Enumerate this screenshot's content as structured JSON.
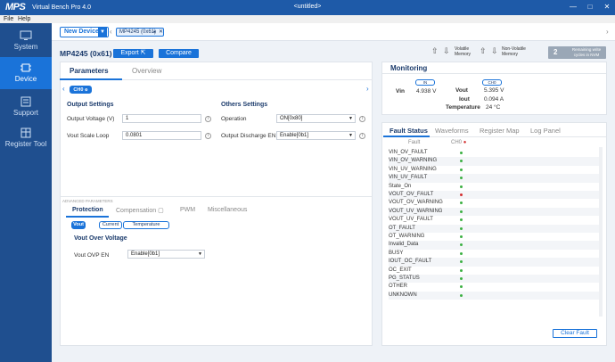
{
  "app": {
    "logo": "MPS",
    "title": "Virtual Bench Pro 4.0",
    "document_title": "<untitled>",
    "window_buttons": [
      "—",
      "□",
      "✕"
    ]
  },
  "menu": [
    "File",
    "Help"
  ],
  "sidebar": [
    {
      "label": "System",
      "icon": "monitor-icon",
      "active": false
    },
    {
      "label": "Device",
      "icon": "chip-icon",
      "active": true
    },
    {
      "label": "Support",
      "icon": "support-icon",
      "active": false
    },
    {
      "label": "Register Tool",
      "icon": "register-tool-icon",
      "active": false
    }
  ],
  "toolbar": {
    "new_device": "New Device",
    "device_tab": "MP4245 (0x61)"
  },
  "device": {
    "title": "MP4245 (0x61)",
    "export_label": "Export",
    "compare_label": "Compare",
    "volatile_label": "Volatile Memory",
    "nonvolatile_label": "Non-Volatile Memory",
    "nvm_count": "2",
    "nvm_text": "Remaining write cycles in NVM"
  },
  "left": {
    "tabs": [
      "Parameters",
      "Overview"
    ],
    "channel": "CH0",
    "output_settings": {
      "title": "Output Settings",
      "rows": [
        {
          "label": "Output Voltage (V)",
          "value": "1"
        },
        {
          "label": "Vout Scale Loop",
          "value": "0.0801"
        }
      ]
    },
    "other_settings": {
      "title": "Others Settings",
      "rows": [
        {
          "label": "Operation",
          "value": "ON[0x80]"
        },
        {
          "label": "Output Discharge EN",
          "value": "Enable[0b1]"
        }
      ]
    },
    "advanced_label": "ADVANCED PARAMETERS",
    "adv_tabs": [
      "Protection",
      "Compensation",
      "PWM",
      "Miscellaneous"
    ],
    "pills": [
      "Vout",
      "Current",
      "Temperature"
    ],
    "ovp": {
      "title": "Vout Over Voltage",
      "label": "Vout OVP EN",
      "value": "Enable[0b1]"
    }
  },
  "monitoring": {
    "title": "Monitoring",
    "vin_badge": "IN",
    "vin_label": "Vin",
    "vin_value": "4.938 V",
    "ch_badge": "CH0",
    "vout_label": "Vout",
    "vout_value": "5.395 V",
    "iout_label": "Iout",
    "iout_value": "0.094 A",
    "temp_label": "Temperature",
    "temp_value": "24 °C"
  },
  "fault": {
    "tabs": [
      "Fault Status",
      "Waveforms",
      "Register Map",
      "Log Panel"
    ],
    "col_fault": "Fault",
    "col_ch": "CH0",
    "rows": [
      {
        "name": "VIN_OV_FAULT",
        "status": "ok"
      },
      {
        "name": "VIN_OV_WARNING",
        "status": "ok"
      },
      {
        "name": "VIN_UV_WARNING",
        "status": "ok"
      },
      {
        "name": "VIN_UV_FAULT",
        "status": "ok"
      },
      {
        "name": "State_On",
        "status": "ok"
      },
      {
        "name": "VOUT_OV_FAULT",
        "status": "fault"
      },
      {
        "name": "VOUT_OV_WARNING",
        "status": "ok"
      },
      {
        "name": "VOUT_UV_WARNING",
        "status": "ok"
      },
      {
        "name": "VOUT_UV_FAULT",
        "status": "ok"
      },
      {
        "name": "OT_FAULT",
        "status": "ok"
      },
      {
        "name": "OT_WARNING",
        "status": "ok"
      },
      {
        "name": "Invalid_Data",
        "status": "ok"
      },
      {
        "name": "BUSY",
        "status": "ok"
      },
      {
        "name": "IOUT_OC_FAULT",
        "status": "ok"
      },
      {
        "name": "OC_EXIT",
        "status": "ok"
      },
      {
        "name": "PG_STATUS",
        "status": "ok"
      },
      {
        "name": "OTHER",
        "status": "ok"
      },
      {
        "name": "UNKNOWN",
        "status": "ok"
      }
    ],
    "clear_label": "Clear Fault"
  },
  "colors": {
    "brand": "#1e5aa8",
    "accent": "#1a73d9",
    "ok": "#3cb043",
    "fault": "#d32f2f"
  }
}
